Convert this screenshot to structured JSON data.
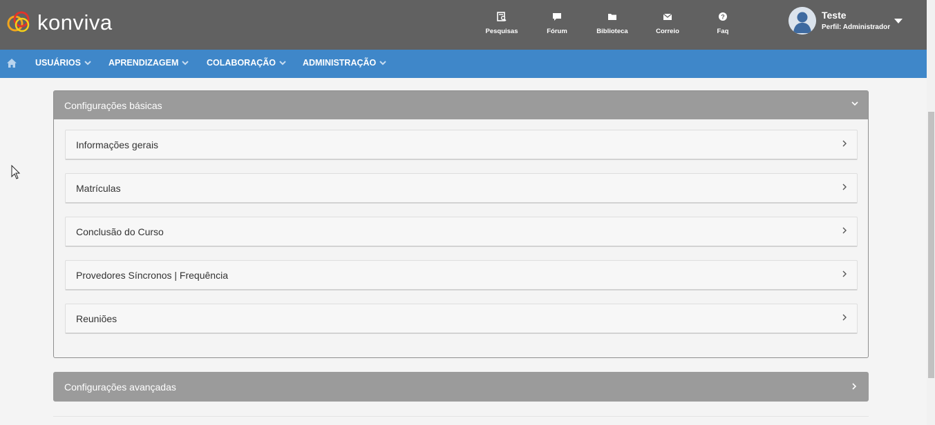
{
  "header": {
    "brand": "konviva",
    "shortcuts": [
      {
        "label": "Pesquisas",
        "icon": "survey-icon"
      },
      {
        "label": "Fórum",
        "icon": "forum-icon"
      },
      {
        "label": "Biblioteca",
        "icon": "folder-icon"
      },
      {
        "label": "Correio",
        "icon": "mail-icon"
      },
      {
        "label": "Faq",
        "icon": "question-icon"
      }
    ],
    "user": {
      "name": "Teste",
      "role": "Perfil: Administrador"
    }
  },
  "nav": {
    "items": [
      {
        "label": "USUÁRIOS"
      },
      {
        "label": "APRENDIZAGEM"
      },
      {
        "label": "COLABORAÇÃO"
      },
      {
        "label": "ADMINISTRAÇÃO"
      }
    ]
  },
  "basic": {
    "title": "Configurações básicas",
    "expanded": true,
    "items": [
      {
        "label": "Informações gerais"
      },
      {
        "label": "Matrículas"
      },
      {
        "label": "Conclusão do Curso"
      },
      {
        "label": "Provedores Síncronos | Frequência"
      },
      {
        "label": "Reuniões"
      }
    ]
  },
  "advanced": {
    "title": "Configurações avançadas",
    "expanded": false
  },
  "colors": {
    "topbar": "#616161",
    "navbar": "#3f87c9",
    "panel_header": "#9b9b9b"
  }
}
